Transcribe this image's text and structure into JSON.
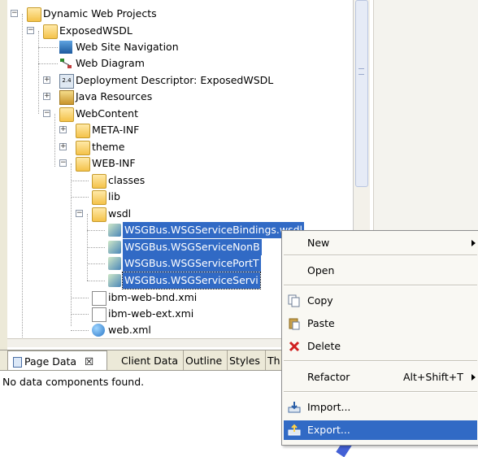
{
  "tree": {
    "items": [
      {
        "label": "Dynamic Web Projects"
      },
      {
        "label": "ExposedWSDL"
      },
      {
        "label": "Web Site Navigation"
      },
      {
        "label": "Web Diagram"
      },
      {
        "label": "Deployment Descriptor: ExposedWSDL"
      },
      {
        "label": "Java Resources"
      },
      {
        "label": "WebContent"
      },
      {
        "label": "META-INF"
      },
      {
        "label": "theme"
      },
      {
        "label": "WEB-INF"
      },
      {
        "label": "classes"
      },
      {
        "label": "lib"
      },
      {
        "label": "wsdl"
      },
      {
        "label": "WSGBus.WSGServiceBindings.wsdl"
      },
      {
        "label": "WSGBus.WSGServiceNonB"
      },
      {
        "label": "WSGBus.WSGServicePortT"
      },
      {
        "label": "WSGBus.WSGServiceServi"
      },
      {
        "label": "ibm-web-bnd.xmi"
      },
      {
        "label": "ibm-web-ext.xmi"
      },
      {
        "label": "web.xml"
      }
    ]
  },
  "tabs": {
    "page_data": "Page Data",
    "page_data_close": "☒",
    "client_data": "Client Data",
    "outline": "Outline",
    "styles": "Styles",
    "thumb": "Th"
  },
  "status": {
    "text": "No data components found."
  },
  "context_menu": {
    "new": "New",
    "open": "Open",
    "copy": "Copy",
    "paste": "Paste",
    "delete": "Delete",
    "refactor": "Refactor",
    "refactor_shortcut": "Alt+Shift+T",
    "import": "Import...",
    "export": "Export..."
  },
  "colors": {
    "selection": "#316ac5",
    "menu_bg": "#f9f8f3"
  }
}
